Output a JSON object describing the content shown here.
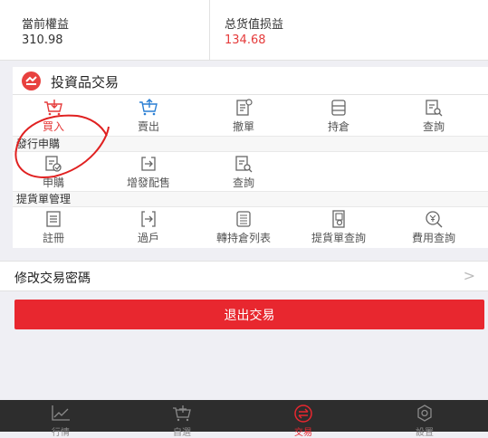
{
  "summary": {
    "left": {
      "label": "當前權益",
      "value": "310.98"
    },
    "right": {
      "label": "总货值损益",
      "value": "134.68"
    }
  },
  "trade_panel": {
    "title": "投資品交易",
    "actions": [
      {
        "label": "買入",
        "icon": "cart-down-icon"
      },
      {
        "label": "賣出",
        "icon": "cart-up-icon"
      },
      {
        "label": "撤單",
        "icon": "cancel-order-icon"
      },
      {
        "label": "持倉",
        "icon": "database-icon"
      },
      {
        "label": "查詢",
        "icon": "search-doc-icon"
      }
    ],
    "ipo_section": {
      "title": "發行申購",
      "items": [
        {
          "label": "申購",
          "icon": "subscribe-icon"
        },
        {
          "label": "增發配售",
          "icon": "exit-arrow-icon"
        },
        {
          "label": "查詢",
          "icon": "search-doc-icon"
        }
      ]
    },
    "delivery_section": {
      "title": "提貨單管理",
      "items": [
        {
          "label": "註冊",
          "icon": "register-doc-icon"
        },
        {
          "label": "過戶",
          "icon": "transfer-icon"
        },
        {
          "label": "轉持倉列表",
          "icon": "list-doc-icon"
        },
        {
          "label": "提貨單查詢",
          "icon": "bill-search-icon"
        },
        {
          "label": "費用查詢",
          "icon": "fee-search-icon"
        }
      ]
    }
  },
  "password_row": {
    "label": "修改交易密碼",
    "arrow": ">"
  },
  "exit_button": {
    "label": "退出交易"
  },
  "tabbar": {
    "tabs": [
      {
        "label": "行情",
        "icon": "chart-line-icon",
        "active": false
      },
      {
        "label": "自選",
        "icon": "cart-icon",
        "active": false
      },
      {
        "label": "交易",
        "icon": "exchange-icon",
        "active": true
      },
      {
        "label": "設置",
        "icon": "gear-icon",
        "active": false
      }
    ]
  },
  "colors": {
    "accent": "#e8272f",
    "profit": "#e53b3b",
    "tabbar_bg": "#2d2d2d",
    "page_bg": "#efeff4"
  }
}
